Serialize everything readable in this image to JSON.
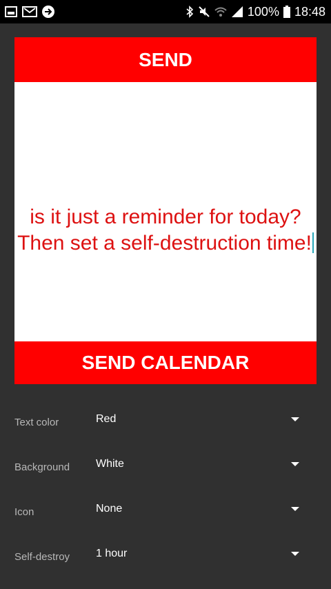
{
  "status_bar": {
    "battery": "100%",
    "time": "18:48",
    "icons": [
      "gallery-icon",
      "mail-icon",
      "sync-icon",
      "bluetooth-icon",
      "mute-icon",
      "wifi-icon",
      "signal-icon",
      "battery-icon"
    ]
  },
  "card": {
    "send_label": "SEND",
    "message": "is it just a reminder for today? Then set a self-destruction time!",
    "send_calendar_label": "SEND CALENDAR"
  },
  "settings": [
    {
      "label": "Text color",
      "value": "Red"
    },
    {
      "label": "Background",
      "value": "White"
    },
    {
      "label": "Icon",
      "value": "None"
    },
    {
      "label": "Self-destroy",
      "value": "1 hour"
    }
  ],
  "colors": {
    "accent": "#ff0000",
    "message_text": "#dd1111",
    "background": "#303030",
    "card_background": "#ffffff"
  }
}
